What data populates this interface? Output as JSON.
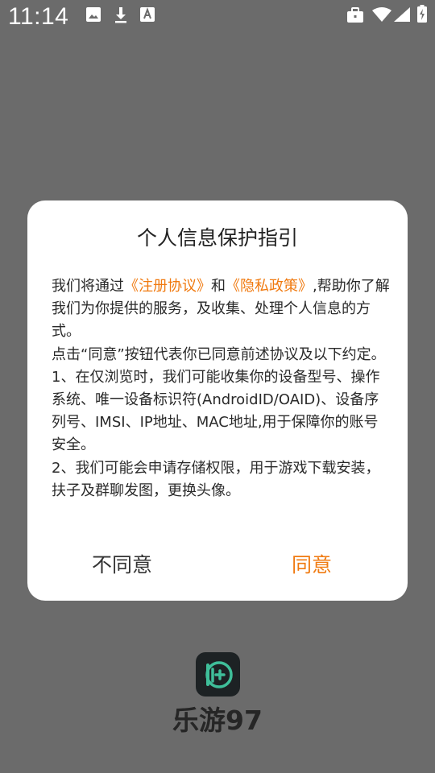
{
  "status_bar": {
    "time": "11:14",
    "icons": [
      "image-icon",
      "download-icon",
      "font-icon",
      "briefcase-icon",
      "wifi-icon",
      "signal-icon",
      "battery-charging-icon"
    ]
  },
  "dialog": {
    "title": "个人信息保护指引",
    "body": {
      "p1_before": "我们将通过",
      "link_register": "《注册协议》",
      "p1_and": "和",
      "link_privacy": "《隐私政策》",
      "p1_after": ",帮助你了解我们为你提供的服务，及收集、处理个人信息的方式。",
      "p2": "点击“同意”按钮代表你已同意前述协议及以下约定。",
      "p3": "1、在仅浏览时，我们可能收集你的设备型号、操作系统、唯一设备标识符(AndroidID/OAID)、设备序列号、IMSI、IP地址、MAC地址,用于保障你的账号安全。",
      "p4": "2、我们可能会申请存储权限，用于游戏下载安装，扶子及群聊发图，更换头像。"
    },
    "disagree_label": "不同意",
    "agree_label": "同意"
  },
  "app": {
    "name": "乐游97",
    "logo_icon": "app-logo-icon"
  },
  "colors": {
    "accent": "#f07a10",
    "overlay": "#6b6b6b",
    "dialog_bg": "#ffffff"
  }
}
